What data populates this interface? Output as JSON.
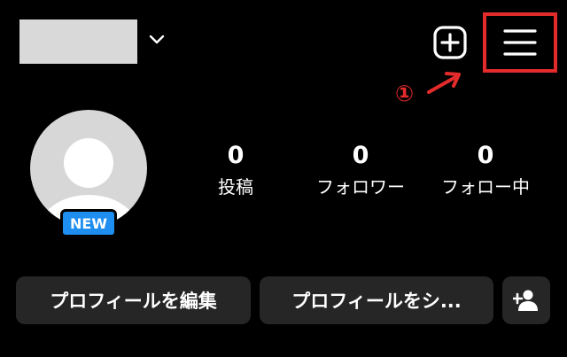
{
  "header": {
    "username_placeholder_color": "#d9d9d9",
    "icons": {
      "dropdown": "chevron-down-icon",
      "create": "plus-square-icon",
      "menu": "hamburger-menu-icon"
    },
    "highlight_color": "#e32b2b"
  },
  "annotation": {
    "number": "①"
  },
  "profile": {
    "badge": "NEW",
    "stats": [
      {
        "value": "0",
        "label": "投稿"
      },
      {
        "value": "0",
        "label": "フォロワー"
      },
      {
        "value": "0",
        "label": "フォロー中"
      }
    ]
  },
  "actions": {
    "edit_label": "プロフィールを編集",
    "share_label": "プロフィールをシ...",
    "discover_icon": "person-add-icon"
  }
}
